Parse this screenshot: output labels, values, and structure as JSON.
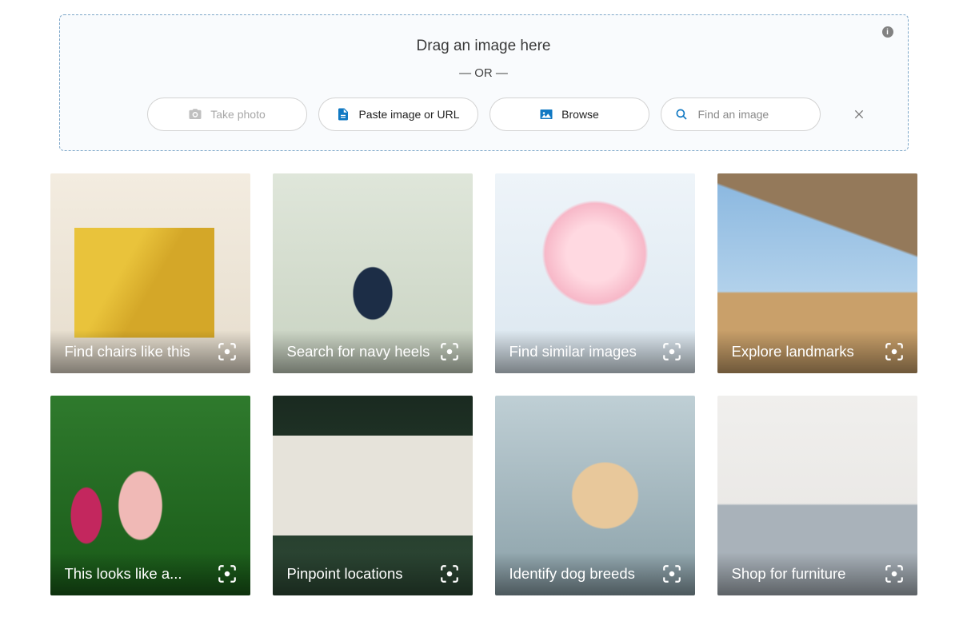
{
  "dropzone": {
    "drag_text": "Drag an image here",
    "or_text": "— OR —",
    "take_photo_label": "Take photo",
    "paste_label": "Paste image or URL",
    "browse_label": "Browse",
    "search_placeholder": "Find an image",
    "search_value": ""
  },
  "cards": [
    {
      "caption": "Find chairs like this"
    },
    {
      "caption": "Search for navy heels"
    },
    {
      "caption": "Find similar images"
    },
    {
      "caption": "Explore landmarks"
    },
    {
      "caption": "This looks like a..."
    },
    {
      "caption": "Pinpoint locations"
    },
    {
      "caption": "Identify dog breeds"
    },
    {
      "caption": "Shop for furniture"
    }
  ]
}
